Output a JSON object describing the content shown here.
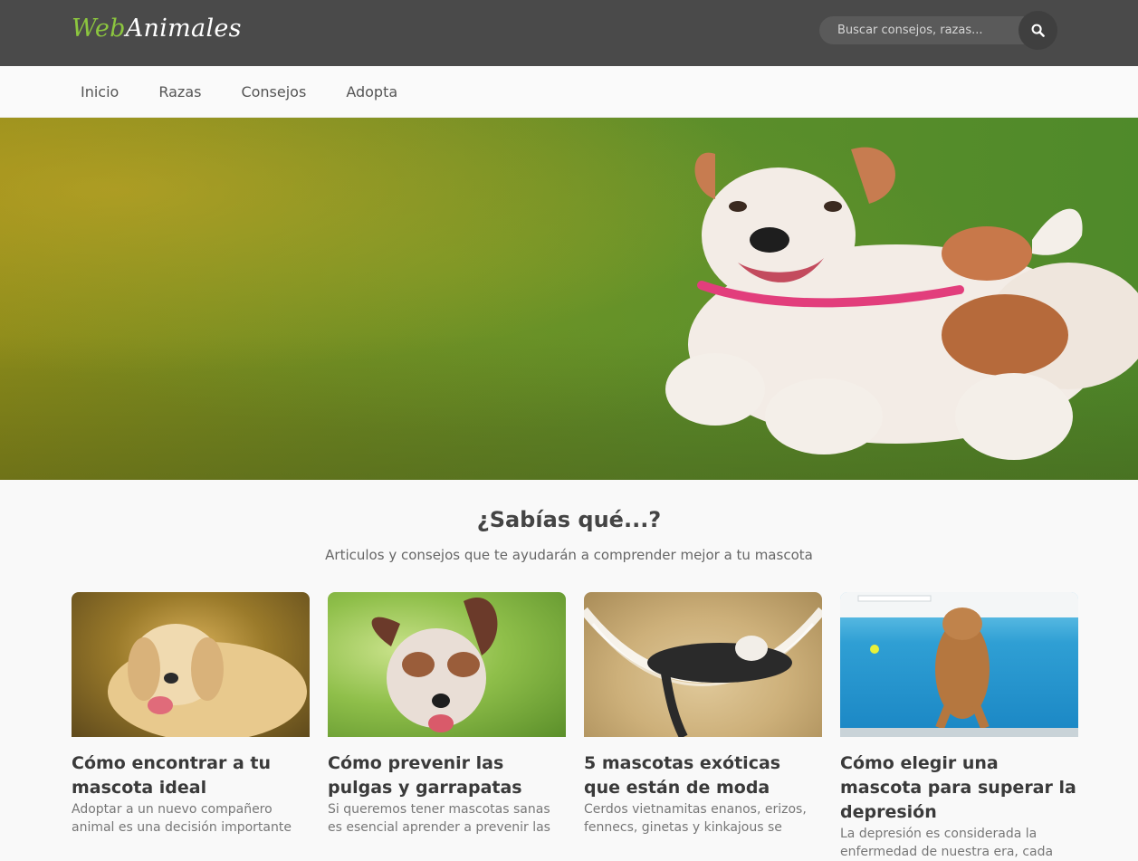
{
  "header": {
    "logo_web": "Web",
    "logo_animales": "Animales",
    "search_placeholder": "Buscar consejos, razas...",
    "brand_color": "#8cc63f"
  },
  "nav": {
    "items": [
      {
        "label": "Inicio"
      },
      {
        "label": "Razas"
      },
      {
        "label": "Consejos"
      },
      {
        "label": "Adopta"
      }
    ]
  },
  "section": {
    "title": "¿Sabías qué...?",
    "subtitle": "Articulos y consejos que te ayudarán a comprender mejor a tu mascota"
  },
  "cards": [
    {
      "title": "Cómo encontrar a tu mascota ideal",
      "excerpt": "Adoptar a un nuevo compañero animal es una decisión importante"
    },
    {
      "title": "Cómo prevenir las pulgas y garrapatas",
      "excerpt": "Si queremos tener mascotas sanas es esencial aprender a prevenir las"
    },
    {
      "title": "5 mascotas exóticas que están de moda",
      "excerpt": "Cerdos vietnamitas enanos, erizos, fennecs, ginetas y kinkajous se"
    },
    {
      "title": "Cómo elegir una mascota para superar la depresión",
      "excerpt": "La depresión es considerada la enfermedad de nuestra era, cada"
    }
  ]
}
